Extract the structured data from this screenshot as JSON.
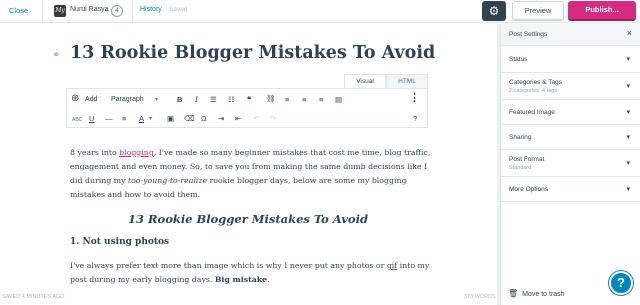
{
  "topbar": {
    "close_label": "Close",
    "site_icon_text": "My",
    "site_name": "Nurul Rasya",
    "site_count": "4",
    "history_label": "History",
    "saved_label": "Saved",
    "preview_label": "Preview",
    "publish_label": "Publish..."
  },
  "editor": {
    "title": "13 Rookie Blogger Mistakes To Avoid",
    "tabs": [
      "Visual",
      "HTML"
    ],
    "toolbar": {
      "add_label": "Add",
      "format_label": "Paragraph"
    },
    "para1_a": "8 years into ",
    "para1_link": "blogging",
    "para1_b": ", I've made so many beginner mistakes that cost me time, blog traffic, engagement and even money. So, to save you from making the same dumb decisions like I did during my ",
    "para1_italic": "too-young-to-realize",
    "para1_c": " rookie blogger days, below are some my blogging mistakes and how to avoid them.",
    "heading2": "13 Rookie Blogger Mistakes To Avoid",
    "heading3": "1. Not using photos",
    "para2_a": "I've always prefer text more than image which is why I never put any photos or ",
    "para2_gif": "gif",
    "para2_b": " into my post during my early blogging days. ",
    "para2_bold": "Big mistake",
    "para2_c": ".",
    "footer_saved": "SAVED 4 MINUTES AGO",
    "footer_words": "373 WORDS"
  },
  "sidebar": {
    "title": "Post Settings",
    "sections": [
      {
        "label": "Status",
        "sub": ""
      },
      {
        "label": "Categories & Tags",
        "sub": "2 categories, 4 tags"
      },
      {
        "label": "Featured Image",
        "sub": ""
      },
      {
        "label": "Sharing",
        "sub": ""
      },
      {
        "label": "Post Format",
        "sub": "Standard"
      },
      {
        "label": "More Options",
        "sub": ""
      }
    ],
    "trash_label": "Move to trash"
  },
  "colors": {
    "accent": "#0087be",
    "publish": "#d52c82",
    "text": "#2e4453"
  }
}
